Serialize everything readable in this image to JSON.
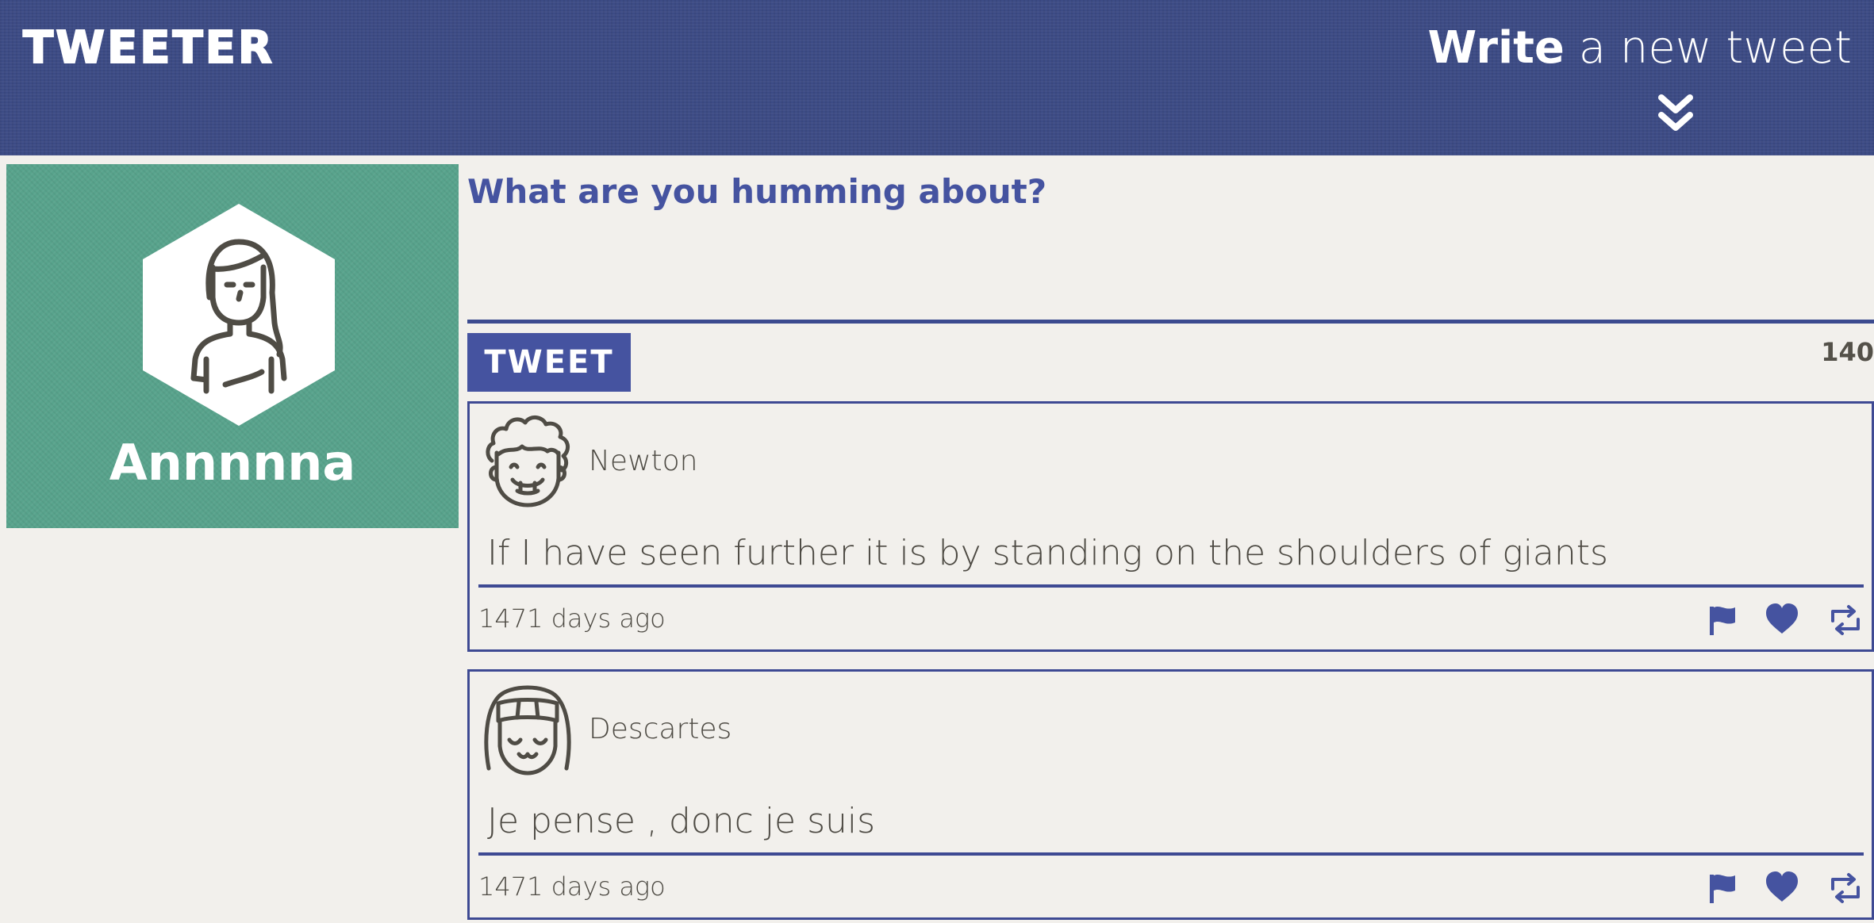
{
  "header": {
    "logo": "TWEETER",
    "compose_toggle_bold": "Write",
    "compose_toggle_rest": " a new tweet",
    "toggle_icon": "double-chevron-down-icon"
  },
  "profile": {
    "name": "Annnnna",
    "avatar_icon": "woman-avatar-icon"
  },
  "compose": {
    "placeholder": "What are you humming about?",
    "button_label": "TWEET",
    "char_counter": "140"
  },
  "tweets": [
    {
      "author": "Newton",
      "avatar_icon": "curly-hair-man-avatar-icon",
      "text": "If I have seen further it is by standing on the shoulders of giants",
      "timestamp": "1471 days ago",
      "actions": [
        "flag-icon",
        "heart-icon",
        "retweet-icon"
      ]
    },
    {
      "author": "Descartes",
      "avatar_icon": "bob-hair-avatar-icon",
      "text": "Je pense , donc je suis",
      "timestamp": "1471 days ago",
      "actions": [
        "flag-icon",
        "heart-icon",
        "retweet-icon"
      ]
    }
  ],
  "colors": {
    "nav_bg": "#3c4b85",
    "accent": "#4553a0",
    "profile_bg": "#58a38c",
    "page_bg": "#f2f0ec",
    "text": "#4d4a43"
  }
}
